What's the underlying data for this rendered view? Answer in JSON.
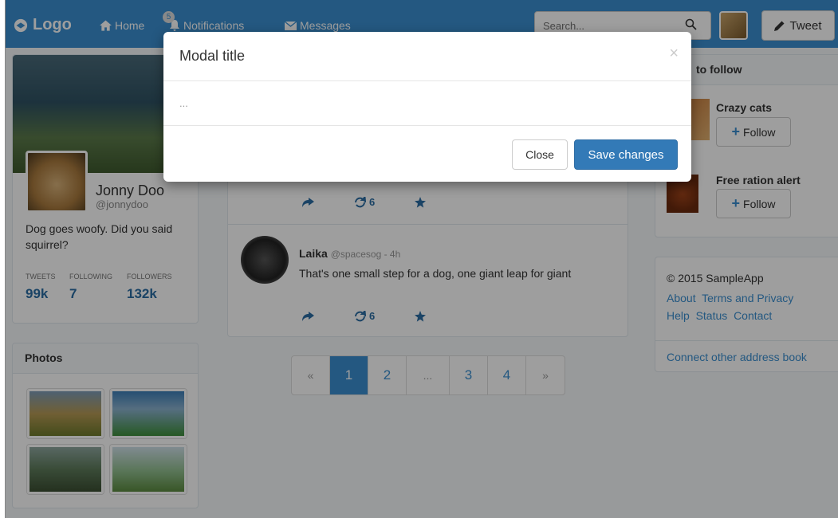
{
  "navbar": {
    "brand": "Logo",
    "home": "Home",
    "notifications": "Notifications",
    "notifications_badge": "5",
    "messages": "Messages",
    "search_placeholder": "Search...",
    "tweet_label": "Tweet"
  },
  "profile": {
    "name": "Jonny Doo",
    "handle": "@jonnydoo",
    "bio": "Dog goes woofy. Did you said squirrel?",
    "stats": [
      {
        "label": "TWEETS",
        "value": "99k"
      },
      {
        "label": "FOLLOWING",
        "value": "7"
      },
      {
        "label": "FOLLOWERS",
        "value": "132k"
      }
    ]
  },
  "photos": {
    "title": "Photos"
  },
  "feed": {
    "tweets": [
      {
        "retweets": "6"
      },
      {
        "author": "Laika",
        "handle": "@spacesog - 4h",
        "text": "That's one small step for a dog, one giant leap for giant",
        "retweets": "6"
      }
    ]
  },
  "pagination": {
    "prev": "«",
    "pages": [
      "1",
      "2",
      "...",
      "3",
      "4"
    ],
    "next": "»",
    "active": "1"
  },
  "who_to_follow": {
    "title": "to follow",
    "users": [
      {
        "name": "Crazy cats",
        "button": "Follow"
      },
      {
        "name": "Free ration alert",
        "button": "Follow"
      }
    ]
  },
  "footer": {
    "copyright": "© 2015 SampleApp",
    "links": [
      "About",
      "Terms and Privacy",
      "Help",
      "Status",
      "Contact"
    ],
    "connect": "Connect other address book"
  },
  "modal": {
    "title": "Modal title",
    "close_glyph": "×",
    "body": "...",
    "close_button": "Close",
    "save_button": "Save changes"
  },
  "colors": {
    "accent": "#3a8fd0",
    "primary_button": "#337ab7",
    "link": "#2a6da3"
  }
}
